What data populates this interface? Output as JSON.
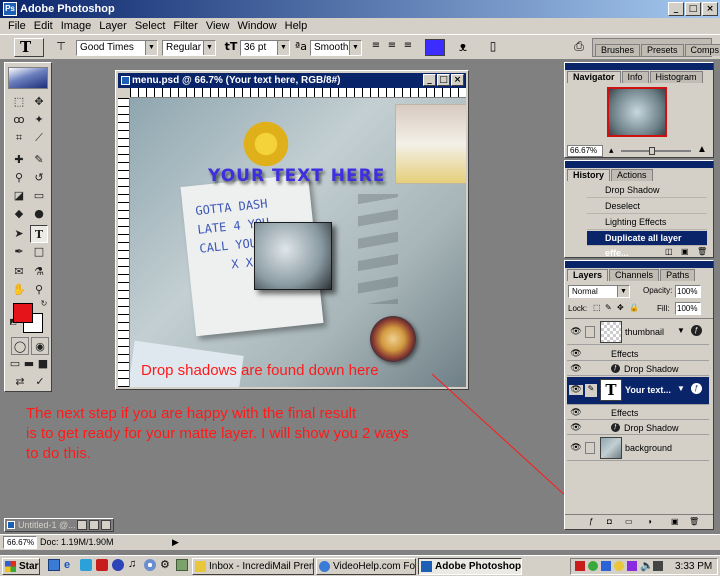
{
  "app": {
    "title": "Adobe Photoshop",
    "icon_label": "Ps"
  },
  "menu": [
    "File",
    "Edit",
    "Image",
    "Layer",
    "Select",
    "Filter",
    "View",
    "Window",
    "Help"
  ],
  "options": {
    "tool_glyph": "T",
    "font_family": "Good Times",
    "font_style": "Regular",
    "font_size": "36 pt",
    "aa_label": "a",
    "antialias": "Smooth",
    "text_color": "#3b2cff",
    "palette_tabs": [
      "Brushes",
      "Presets",
      "Comps"
    ]
  },
  "document": {
    "title": "menu.psd @ 66.7% (Your text here, RGB/8#)",
    "headline": "YOUR TEXT HERE",
    "note_lines": [
      "GOTTA DASH",
      "LATE 4 YOU",
      "CALL YOU",
      "X X"
    ]
  },
  "navigator": {
    "tabs": [
      "Navigator",
      "Info",
      "Histogram"
    ],
    "zoom": "66.67%"
  },
  "history": {
    "tabs": [
      "History",
      "Actions"
    ],
    "items": [
      "Drop Shadow",
      "Deselect",
      "Lighting Effects",
      "Duplicate all layer effe..."
    ]
  },
  "layers": {
    "tabs": [
      "Layers",
      "Channels",
      "Paths"
    ],
    "blend_mode": "Normal",
    "opacity_label": "Opacity:",
    "opacity": "100%",
    "lock_label": "Lock:",
    "fill_label": "Fill:",
    "fill": "100%",
    "rows": [
      {
        "name": "thumbnail"
      },
      {
        "name": "Effects"
      },
      {
        "name": "Drop Shadow"
      },
      {
        "name": "Your text..."
      },
      {
        "name": "Effects"
      },
      {
        "name": "Drop Shadow"
      },
      {
        "name": "background"
      }
    ],
    "text_thumb_glyph": "T"
  },
  "annotations": {
    "pointer": "Drop shadows are found down here",
    "instruction_lines": [
      "The next step if you are happy with the final result",
      "is to get ready for your matte layer. I will show you 2 ways",
      "to do this."
    ],
    "color": "#ff1a1a"
  },
  "minimized_doc": {
    "title": "Untitled-1 @..."
  },
  "status": {
    "zoom": "66.67%",
    "doc": "Doc: 1.19M/1.90M"
  },
  "taskbar": {
    "start": "Start",
    "tasks": [
      "Inbox - IncrediMail Premium",
      "VideoHelp.com Forums :...",
      "Adobe Photoshop"
    ],
    "clock": "3:33 PM"
  },
  "colors": {
    "foreground": "#e4141a",
    "background": "#ffffff"
  }
}
